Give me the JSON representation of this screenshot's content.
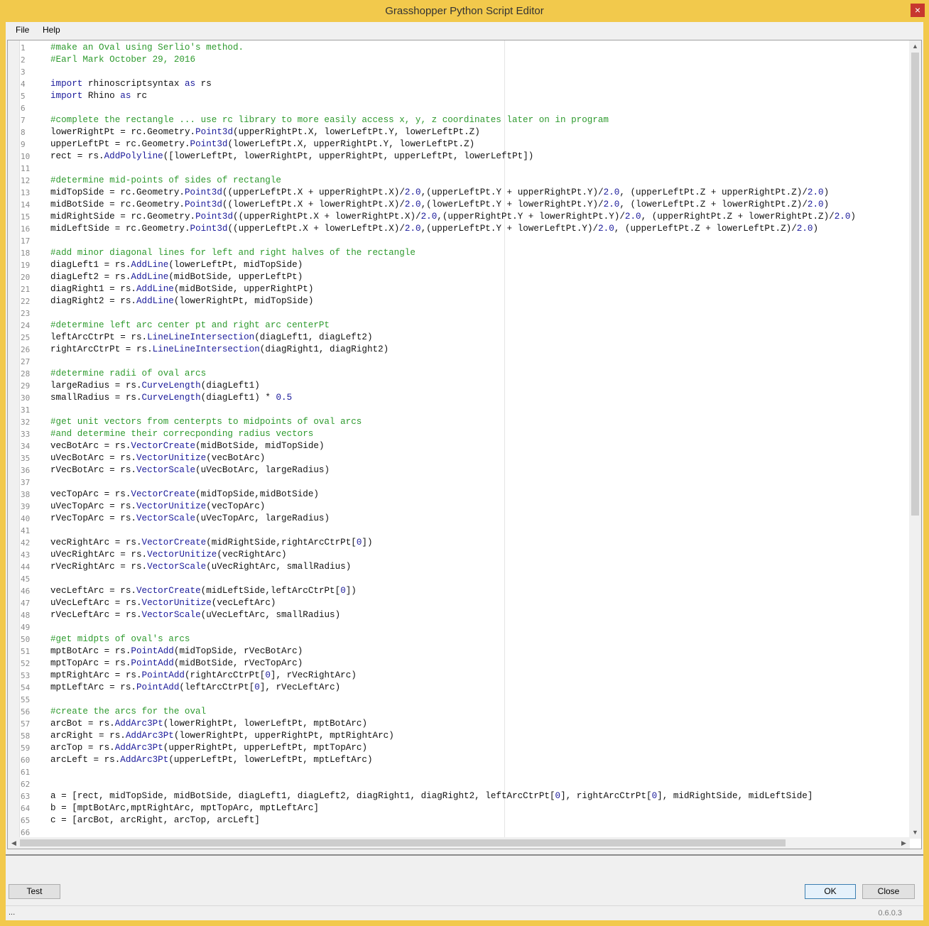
{
  "window": {
    "title": "Grasshopper Python Script Editor",
    "close_label": "×"
  },
  "menu": {
    "file": "File",
    "help": "Help"
  },
  "buttons": {
    "test": "Test",
    "ok": "OK",
    "close": "Close"
  },
  "status": {
    "left": "...",
    "version": "0.6.0.3"
  },
  "editor": {
    "line_numbers": [
      "1",
      "2",
      "3",
      "4",
      "5",
      "6",
      "7",
      "8",
      "9",
      "10",
      "11",
      "12",
      "13",
      "14",
      "15",
      "16",
      "17",
      "18",
      "19",
      "20",
      "21",
      "22",
      "23",
      "24",
      "25",
      "26",
      "27",
      "28",
      "29",
      "30",
      "31",
      "32",
      "33",
      "34",
      "35",
      "36",
      "37",
      "38",
      "39",
      "40",
      "41",
      "42",
      "43",
      "44",
      "45",
      "46",
      "47",
      "48",
      "49",
      "50",
      "51",
      "52",
      "53",
      "54",
      "55",
      "56",
      "57",
      "58",
      "59",
      "60",
      "61",
      "62",
      "63",
      "64",
      "65",
      "66"
    ],
    "lines": [
      "#make an Oval using Serlio's method.",
      "#Earl Mark October 29, 2016",
      "",
      "import rhinoscriptsyntax as rs",
      "import Rhino as rc",
      "",
      "#complete the rectangle ... use rc library to more easily access x, y, z coordinates later on in program",
      "lowerRightPt = rc.Geometry.Point3d(upperRightPt.X, lowerLeftPt.Y, lowerLeftPt.Z)",
      "upperLeftPt = rc.Geometry.Point3d(lowerLeftPt.X, upperRightPt.Y, lowerLeftPt.Z)",
      "rect = rs.AddPolyline([lowerLeftPt, lowerRightPt, upperRightPt, upperLeftPt, lowerLeftPt])",
      "",
      "#determine mid-points of sides of rectangle",
      "midTopSide = rc.Geometry.Point3d((upperLeftPt.X + upperRightPt.X)/2.0,(upperLeftPt.Y + upperRightPt.Y)/2.0, (upperLeftPt.Z + upperRightPt.Z)/2.0)",
      "midBotSide = rc.Geometry.Point3d((lowerLeftPt.X + lowerRightPt.X)/2.0,(lowerLeftPt.Y + lowerRightPt.Y)/2.0, (lowerLeftPt.Z + lowerRightPt.Z)/2.0)",
      "midRightSide = rc.Geometry.Point3d((upperRightPt.X + lowerRightPt.X)/2.0,(upperRightPt.Y + lowerRightPt.Y)/2.0, (upperRightPt.Z + lowerRightPt.Z)/2.0)",
      "midLeftSide = rc.Geometry.Point3d((upperLeftPt.X + lowerLeftPt.X)/2.0,(upperLeftPt.Y + lowerLeftPt.Y)/2.0, (upperLeftPt.Z + lowerLeftPt.Z)/2.0)",
      "",
      "#add minor diagonal lines for left and right halves of the rectangle",
      "diagLeft1 = rs.AddLine(lowerLeftPt, midTopSide)",
      "diagLeft2 = rs.AddLine(midBotSide, upperLeftPt)",
      "diagRight1 = rs.AddLine(midBotSide, upperRightPt)",
      "diagRight2 = rs.AddLine(lowerRightPt, midTopSide)",
      "",
      "#determine left arc center pt and right arc centerPt",
      "leftArcCtrPt = rs.LineLineIntersection(diagLeft1, diagLeft2)",
      "rightArcCtrPt = rs.LineLineIntersection(diagRight1, diagRight2)",
      "",
      "#determine radii of oval arcs",
      "largeRadius = rs.CurveLength(diagLeft1)",
      "smallRadius = rs.CurveLength(diagLeft1) * 0.5",
      "",
      "#get unit vectors from centerpts to midpoints of oval arcs",
      "#and determine their correcponding radius vectors",
      "vecBotArc = rs.VectorCreate(midBotSide, midTopSide)",
      "uVecBotArc = rs.VectorUnitize(vecBotArc)",
      "rVecBotArc = rs.VectorScale(uVecBotArc, largeRadius)",
      "",
      "vecTopArc = rs.VectorCreate(midTopSide,midBotSide)",
      "uVecTopArc = rs.VectorUnitize(vecTopArc)",
      "rVecTopArc = rs.VectorScale(uVecTopArc, largeRadius)",
      "",
      "vecRightArc = rs.VectorCreate(midRightSide,rightArcCtrPt[0])",
      "uVecRightArc = rs.VectorUnitize(vecRightArc)",
      "rVecRightArc = rs.VectorScale(uVecRightArc, smallRadius)",
      "",
      "vecLeftArc = rs.VectorCreate(midLeftSide,leftArcCtrPt[0])",
      "uVecLeftArc = rs.VectorUnitize(vecLeftArc)",
      "rVecLeftArc = rs.VectorScale(uVecLeftArc, smallRadius)",
      "",
      "#get midpts of oval's arcs",
      "mptBotArc = rs.PointAdd(midTopSide, rVecBotArc)",
      "mptTopArc = rs.PointAdd(midBotSide, rVecTopArc)",
      "mptRightArc = rs.PointAdd(rightArcCtrPt[0], rVecRightArc)",
      "mptLeftArc = rs.PointAdd(leftArcCtrPt[0], rVecLeftArc)",
      "",
      "#create the arcs for the oval",
      "arcBot = rs.AddArc3Pt(lowerRightPt, lowerLeftPt, mptBotArc)",
      "arcRight = rs.AddArc3Pt(lowerRightPt, upperRightPt, mptRightArc)",
      "arcTop = rs.AddArc3Pt(upperRightPt, upperLeftPt, mptTopArc)",
      "arcLeft = rs.AddArc3Pt(upperLeftPt, lowerLeftPt, mptLeftArc)",
      "",
      "",
      "a = [rect, midTopSide, midBotSide, diagLeft1, diagLeft2, diagRight1, diagRight2, leftArcCtrPt[0], rightArcCtrPt[0], midRightSide, midLeftSide]",
      "b = [mptBotArc,mptRightArc, mptTopArc, mptLeftArc]",
      "c = [arcBot, arcRight, arcTop, arcLeft]",
      ""
    ]
  }
}
